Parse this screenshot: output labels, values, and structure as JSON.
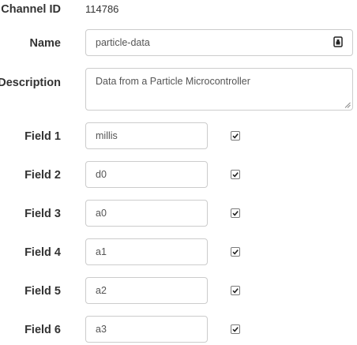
{
  "channel": {
    "id_label": "Channel ID",
    "id_value": "114786",
    "name_label": "Name",
    "name_value": "particle-data",
    "name_icon": "password-manager-icon",
    "description_label": "Description",
    "description_value": "Data from a Particle Microcontroller"
  },
  "fields": [
    {
      "label": "Field 1",
      "value": "millis",
      "checked": true
    },
    {
      "label": "Field 2",
      "value": "d0",
      "checked": true
    },
    {
      "label": "Field 3",
      "value": "a0",
      "checked": true
    },
    {
      "label": "Field 4",
      "value": "a1",
      "checked": true
    },
    {
      "label": "Field 5",
      "value": "a2",
      "checked": true
    },
    {
      "label": "Field 6",
      "value": "a3",
      "checked": true
    }
  ]
}
